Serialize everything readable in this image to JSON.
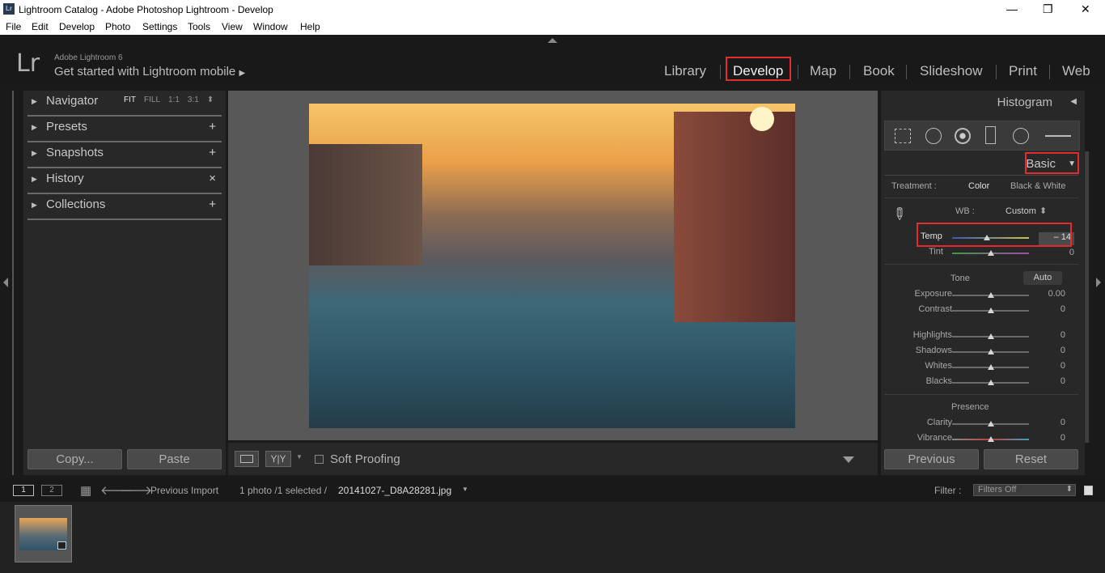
{
  "window": {
    "title": "Lightroom Catalog - Adobe Photoshop Lightroom - Develop",
    "app_icon": "Lr"
  },
  "menu": [
    "File",
    "Edit",
    "Develop",
    "Photo",
    "Settings",
    "Tools",
    "View",
    "Window",
    "Help"
  ],
  "identity": {
    "logo": "Lr",
    "brand": "Adobe Lightroom 6",
    "mobile": "Get started with Lightroom mobile",
    "mobile_arrow": "▶"
  },
  "modules": [
    "Library",
    "Develop",
    "Map",
    "Book",
    "Slideshow",
    "Print",
    "Web"
  ],
  "left_panel": {
    "navigator": {
      "label": "Navigator",
      "options": [
        "FIT",
        "FILL",
        "1:1",
        "3:1"
      ],
      "more": "⬍"
    },
    "presets": {
      "label": "Presets",
      "action": "+"
    },
    "snapshots": {
      "label": "Snapshots",
      "action": "+"
    },
    "history": {
      "label": "History",
      "action": "×"
    },
    "collections": {
      "label": "Collections",
      "action": "+"
    },
    "copy_label": "Copy...",
    "paste_label": "Paste"
  },
  "toolbar": {
    "soft_proofing": "Soft Proofing",
    "yy": "Y|Y"
  },
  "right_panel": {
    "histogram": "Histogram",
    "basic": "Basic",
    "treatment_label": "Treatment :",
    "treatment_color": "Color",
    "treatment_bw": "Black & White",
    "wb_label": "WB :",
    "wb_value": "Custom",
    "temp_label": "Temp",
    "temp_value": "– 14",
    "tint_label": "Tint",
    "tint_value": "0",
    "tone_label": "Tone",
    "auto_label": "Auto",
    "exposure_label": "Exposure",
    "exposure_value": "0.00",
    "contrast_label": "Contrast",
    "contrast_value": "0",
    "highlights_label": "Highlights",
    "highlights_value": "0",
    "shadows_label": "Shadows",
    "shadows_value": "0",
    "whites_label": "Whites",
    "whites_value": "0",
    "blacks_label": "Blacks",
    "blacks_value": "0",
    "presence_label": "Presence",
    "clarity_label": "Clarity",
    "clarity_value": "0",
    "vibrance_label": "Vibrance",
    "vibrance_value": "0",
    "previous_label": "Previous",
    "reset_label": "Reset"
  },
  "filmbar": {
    "page1": "1",
    "page2": "2",
    "source": "Previous Import",
    "count": "1 photo /1 selected /",
    "filename": "20141027-_D8A28281.jpg",
    "filter_label": "Filter :",
    "filter_value": "Filters Off"
  },
  "colors": {
    "accent_red": "#e32b2b",
    "panel_bg": "#282828",
    "canvas_bg": "#585858"
  }
}
